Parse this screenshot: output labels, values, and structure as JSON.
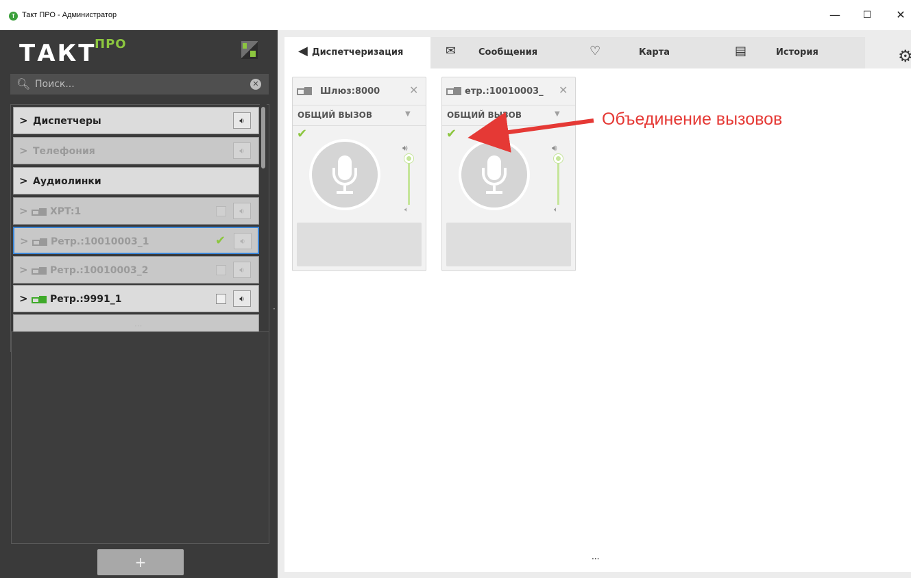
{
  "window": {
    "title": "Такт ПРО - Администратор",
    "app_icon_letter": "Т",
    "minimize": "—",
    "maximize": "☐",
    "close": "✕"
  },
  "logo": {
    "text": "ТАКТ",
    "superscript": "ПРО"
  },
  "search": {
    "placeholder": "Поиск..."
  },
  "sidebar": {
    "items": [
      {
        "label": "Диспетчеры",
        "expanded": false,
        "dim": false,
        "type": "group",
        "has_checkbox": false
      },
      {
        "label": "Телефония",
        "expanded": false,
        "dim": true,
        "type": "group",
        "has_checkbox": false
      },
      {
        "label": "Аудиолинки",
        "expanded": false,
        "dim": false,
        "type": "group",
        "has_checkbox": false
      },
      {
        "label": "XPT:1",
        "dim": true,
        "type": "device",
        "checked": false
      },
      {
        "label": "Ретр.:10010003_1",
        "dim": true,
        "type": "device",
        "checked": true,
        "selected": true
      },
      {
        "label": "Ретр.:10010003_2",
        "dim": true,
        "type": "device",
        "checked": false
      },
      {
        "label": "Ретр.:9991_1",
        "dim": false,
        "type": "device",
        "checked": false,
        "online": true
      }
    ],
    "add_button": "+"
  },
  "tabs": [
    {
      "label": "Диспетчеризация",
      "icon": "speaker-circle-icon",
      "active": true
    },
    {
      "label": "Сообщения",
      "icon": "envelope-icon",
      "active": false
    },
    {
      "label": "Карта",
      "icon": "map-pin-icon",
      "active": false
    },
    {
      "label": "История",
      "icon": "document-icon",
      "active": false
    }
  ],
  "cards": [
    {
      "title": "Шлюз:8000",
      "mode": "ОБЩИЙ ВЫЗОВ",
      "checked": true
    },
    {
      "title": "етр.:10010003_",
      "mode": "ОБЩИЙ ВЫЗОВ",
      "checked": true
    }
  ],
  "annotation": {
    "text": "Объединение вызовов",
    "color": "#e53935"
  },
  "colors": {
    "accent_green": "#8cc63f",
    "device_online": "#3faa2a",
    "selection_blue": "#3b86d8"
  }
}
